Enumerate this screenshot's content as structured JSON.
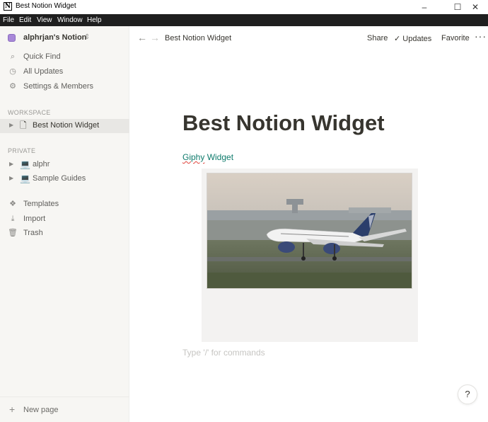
{
  "window": {
    "title": "Best Notion Widget",
    "app_icon": "N",
    "controls": {
      "minimize": "–",
      "maximize": "☐",
      "close": "✕"
    }
  },
  "menubar": [
    "File",
    "Edit",
    "View",
    "Window",
    "Help"
  ],
  "sidebar": {
    "workspace_name": "alphrjan's Notion",
    "workspace_chevron": "⌃⌄",
    "top_items": [
      {
        "label": "Quick Find",
        "icon": "search-icon",
        "glyph": "⌕"
      },
      {
        "label": "All Updates",
        "icon": "clock-icon",
        "glyph": "◷"
      },
      {
        "label": "Settings & Members",
        "icon": "gear-icon",
        "glyph": "⚙"
      }
    ],
    "workspace_section": "WORKSPACE",
    "workspace_pages": [
      {
        "label": "Best Notion Widget",
        "icon": "page-icon",
        "glyph": "🗋"
      }
    ],
    "private_section": "PRIVATE",
    "private_pages": [
      {
        "label": "alphr",
        "icon": "laptop-icon",
        "glyph": "💻"
      },
      {
        "label": "Sample Guides",
        "icon": "laptop-icon",
        "glyph": "💻"
      }
    ],
    "bottom_items": [
      {
        "label": "Templates",
        "icon": "templates-icon",
        "glyph": "❖"
      },
      {
        "label": "Import",
        "icon": "import-icon",
        "glyph": "⤓"
      },
      {
        "label": "Trash",
        "icon": "trash-icon",
        "glyph": "🗑"
      }
    ],
    "new_page": "New page"
  },
  "topbar": {
    "back": "←",
    "forward": "→",
    "breadcrumb": "Best Notion Widget",
    "share": "Share",
    "updates_check": "✓",
    "updates": "Updates",
    "favorite": "Favorite",
    "more": "···"
  },
  "page": {
    "title": "Best Notion Widget",
    "embed_link_word": "Giphy",
    "embed_link_rest": " Widget",
    "placeholder": "Type '/' for commands"
  },
  "help": "?",
  "colors": {
    "sidebar_bg": "#f7f6f3",
    "accent_link": "#0f7b6c",
    "menubar_bg": "#1f1f1f"
  }
}
